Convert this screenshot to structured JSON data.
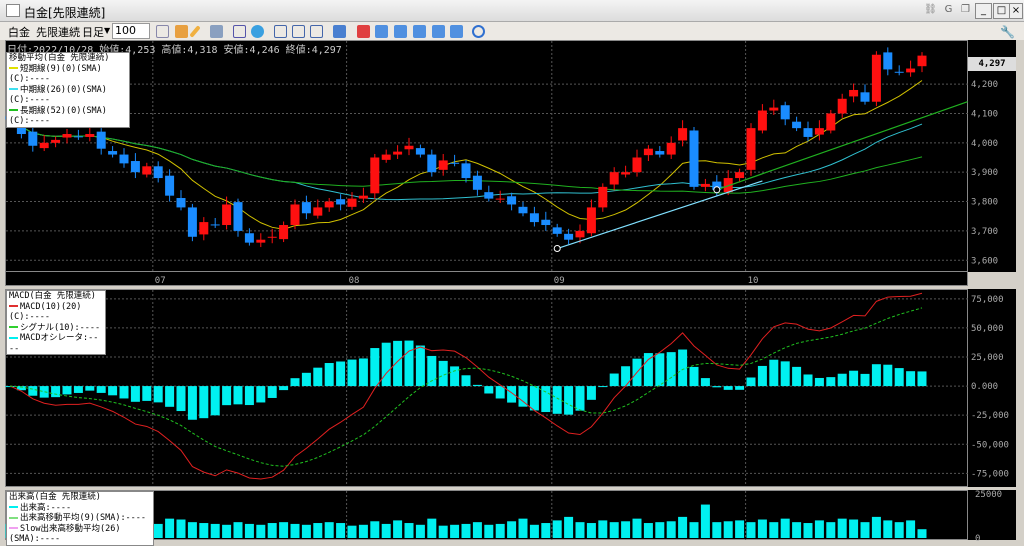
{
  "window": {
    "title": "白金[先限連続]"
  },
  "toolbar": {
    "symbol": "白金",
    "contract": "先限連続",
    "period": "日足",
    "count": "100"
  },
  "info": {
    "text": "日付:2022/10/28 始値:4,253 高値:4,318 安値:4,246 終値:4,297"
  },
  "price_panel": {
    "legend_title": "移動平均(白金 先限連続)",
    "legend": [
      {
        "label": "短期線(9)(0)(SMA)(C):----",
        "color": "#e0e000"
      },
      {
        "label": "中期線(26)(0)(SMA)(C):----",
        "color": "#40e0f0"
      },
      {
        "label": "長期線(52)(0)(SMA)(C):----",
        "color": "#20c020"
      }
    ],
    "last_price": "4,297",
    "ticks": [
      "4,200",
      "4,100",
      "4,000",
      "3,900",
      "3,800",
      "3,700",
      "3,600"
    ],
    "date_labels": [
      {
        "label": "07",
        "index": 12
      },
      {
        "label": "08",
        "index": 29
      },
      {
        "label": "09",
        "index": 47
      },
      {
        "label": "10",
        "index": 64
      }
    ]
  },
  "macd_panel": {
    "legend_title": "MACD(白金 先限連続)",
    "legend": [
      {
        "label": "MACD(10)(20)(C):----",
        "color": "#e03030"
      },
      {
        "label": "シグナル(10):----",
        "color": "#30d030"
      },
      {
        "label": "MACDオシレータ:----",
        "color": "#00f0f0"
      }
    ],
    "ticks": [
      "75,000",
      "50,000",
      "25,000",
      "0.000",
      "-25,000",
      "-50,000",
      "-75,000"
    ]
  },
  "volume_panel": {
    "legend_title": "出来高(白金 先限連続)",
    "legend": [
      {
        "label": "出来高:----",
        "color": "#00f0f0"
      },
      {
        "label": "出来高移動平均(9)(SMA):----",
        "color": "#80e080"
      },
      {
        "label": "Slow出来高移動平均(26)(SMA):----",
        "color": "#f0a0f0"
      }
    ],
    "ticks": [
      "25000",
      "0"
    ]
  },
  "chart_data": {
    "type": "candlestick",
    "price_range": [
      3560,
      4340
    ],
    "closes": [
      4080,
      4030,
      3990,
      4000,
      4010,
      4030,
      4020,
      4030,
      3980,
      3960,
      3930,
      3900,
      3920,
      3880,
      3820,
      3780,
      3680,
      3730,
      3720,
      3790,
      3700,
      3660,
      3670,
      3680,
      3720,
      3790,
      3760,
      3780,
      3800,
      3790,
      3810,
      3820,
      3950,
      3960,
      3970,
      3990,
      3960,
      3900,
      3940,
      3930,
      3880,
      3840,
      3810,
      3810,
      3790,
      3760,
      3730,
      3720,
      3690,
      3670,
      3700,
      3780,
      3850,
      3900,
      3900,
      3950,
      3980,
      3960,
      4000,
      4050,
      3850,
      3860,
      3840,
      3880,
      3900,
      4050,
      4110,
      4120,
      4080,
      4050,
      4020,
      4050,
      4100,
      4150,
      4180,
      4140,
      4300,
      4250,
      4240,
      4253,
      4297
    ],
    "volumes": [
      8000,
      9000,
      7500,
      8500,
      7000,
      8000,
      9500,
      8000,
      7000,
      7500,
      8500,
      7000,
      9000,
      8000,
      11000,
      10500,
      9000,
      8500,
      8000,
      7500,
      9000,
      8000,
      7500,
      8500,
      9000,
      8000,
      7500,
      8500,
      9000,
      8500,
      7000,
      7500,
      9500,
      8000,
      10000,
      8500,
      7500,
      11000,
      7000,
      7500,
      8000,
      9000,
      7500,
      8000,
      9500,
      11000,
      7500,
      8500,
      10000,
      12000,
      9000,
      8500,
      10000,
      9000,
      9500,
      11000,
      8500,
      9000,
      9500,
      12000,
      9000,
      19000,
      9000,
      9500,
      10000,
      9000,
      10500,
      9000,
      11000,
      9000,
      8500,
      10000,
      9000,
      11000,
      10500,
      9000,
      12000,
      10000,
      9000,
      10000,
      5000
    ],
    "macd_range": [
      -85000,
      80000
    ],
    "volume_range": [
      0,
      25000
    ],
    "trendlines": [
      {
        "from": [
          48,
          3640
        ],
        "to": [
          66,
          3870
        ],
        "color": "#80e0ff"
      },
      {
        "from": [
          62,
          3840
        ],
        "to": [
          84,
          4140
        ],
        "color": "#20b020"
      }
    ]
  }
}
